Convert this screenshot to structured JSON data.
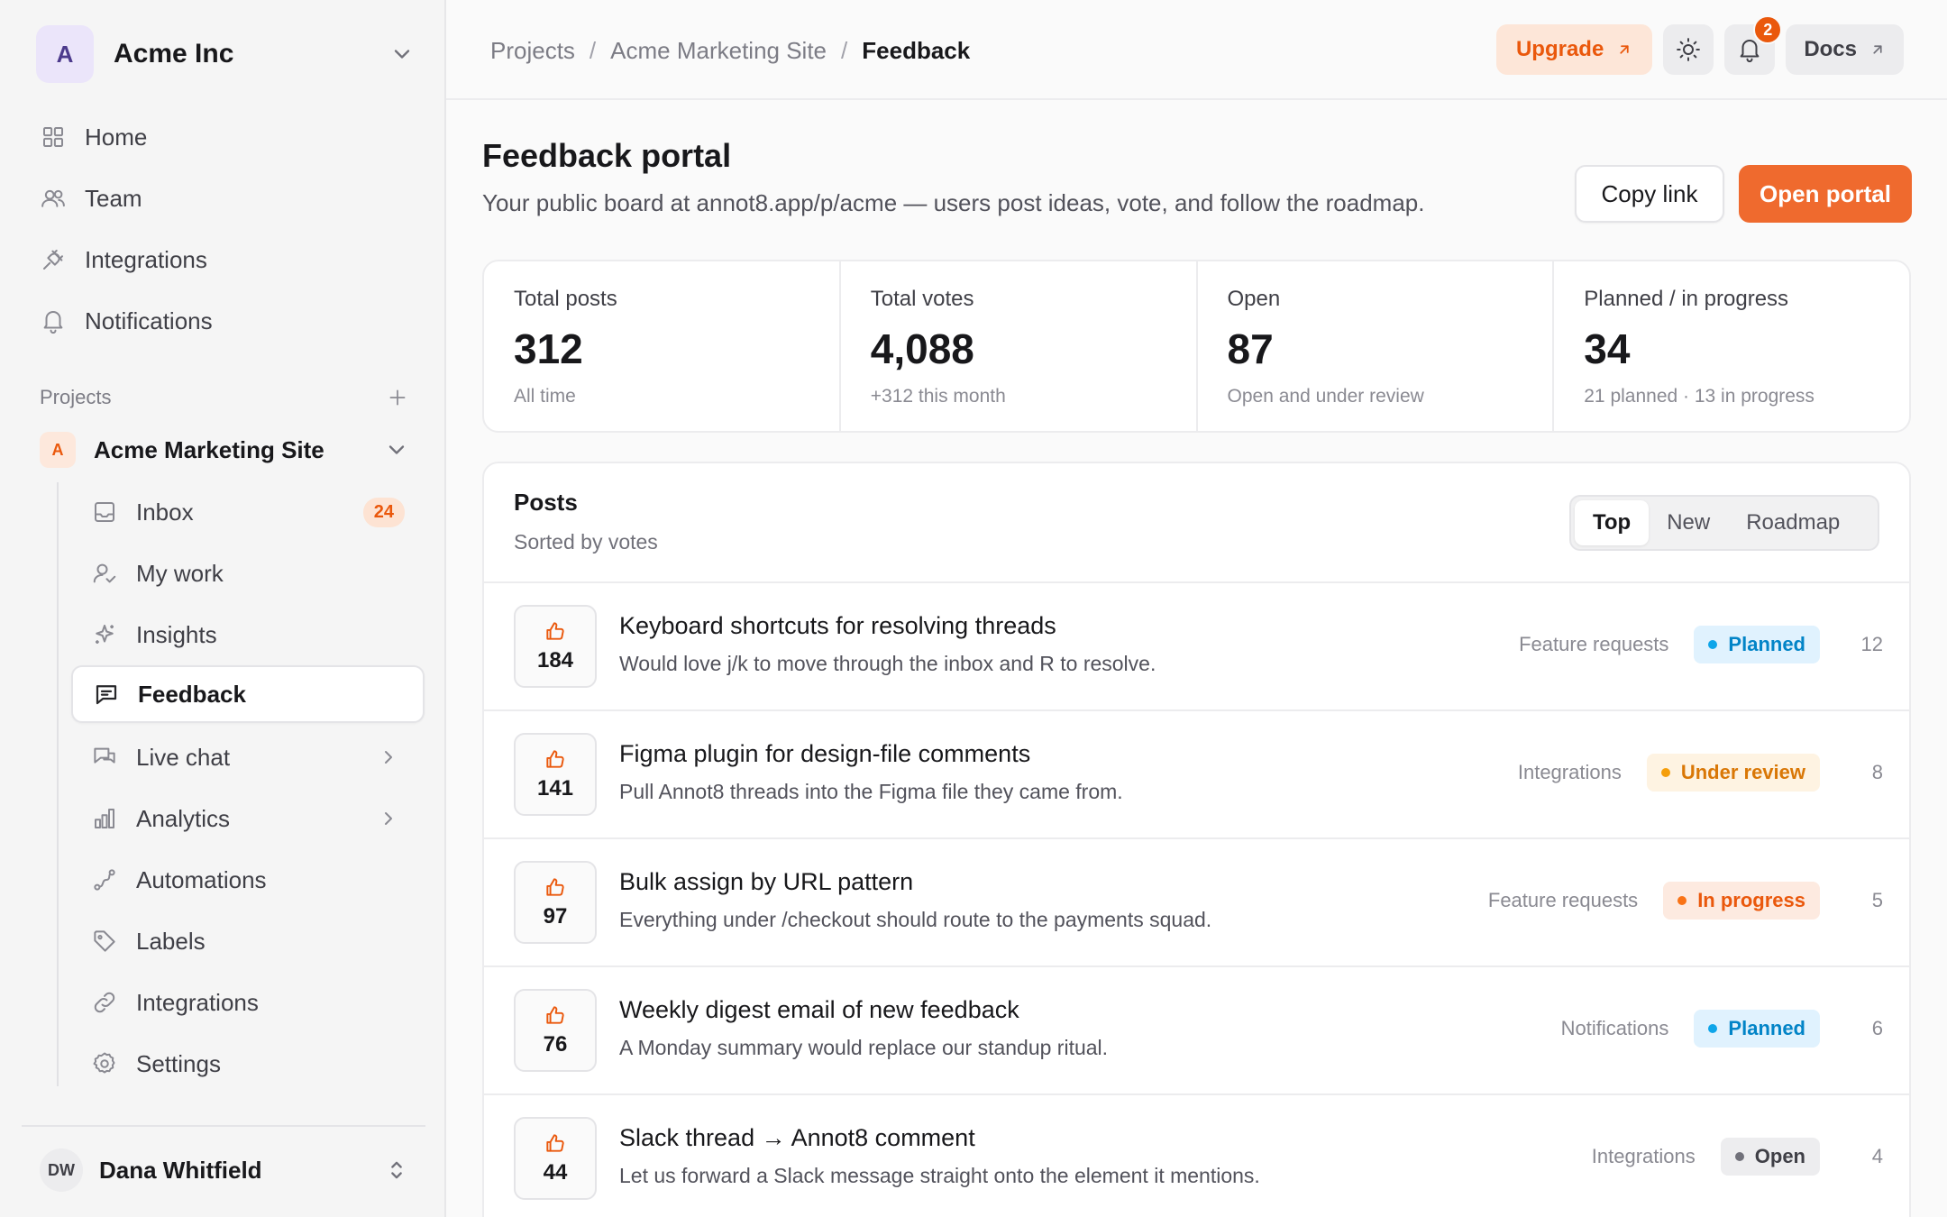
{
  "org": {
    "initial": "A",
    "name": "Acme Inc"
  },
  "nav": [
    {
      "label": "Home",
      "icon": "grid-icon"
    },
    {
      "label": "Team",
      "icon": "users-icon"
    },
    {
      "label": "Integrations",
      "icon": "plug-icon"
    },
    {
      "label": "Notifications",
      "icon": "bell-icon"
    }
  ],
  "projects": {
    "heading": "Projects",
    "current": {
      "initial": "A",
      "name": "Acme Marketing Site"
    },
    "items": [
      {
        "label": "Inbox",
        "icon": "inbox-icon",
        "badge": "24"
      },
      {
        "label": "My work",
        "icon": "user-check-icon"
      },
      {
        "label": "Insights",
        "icon": "sparkles-icon"
      },
      {
        "label": "Feedback",
        "icon": "message-square-icon",
        "active": true
      },
      {
        "label": "Live chat",
        "icon": "chat-icon",
        "expandable": true
      },
      {
        "label": "Analytics",
        "icon": "bar-chart-icon",
        "expandable": true
      },
      {
        "label": "Automations",
        "icon": "route-icon"
      },
      {
        "label": "Labels",
        "icon": "tag-icon"
      },
      {
        "label": "Integrations",
        "icon": "link-icon"
      },
      {
        "label": "Settings",
        "icon": "gear-icon"
      }
    ]
  },
  "user": {
    "initials": "DW",
    "name": "Dana Whitfield"
  },
  "breadcrumb": {
    "items": [
      "Projects",
      "Acme Marketing Site"
    ],
    "separator": "/",
    "current": "Feedback"
  },
  "topbar": {
    "upgrade": "Upgrade",
    "notifications_count": "2",
    "docs": "Docs"
  },
  "page": {
    "title": "Feedback portal",
    "subtitle": "Your public board at annot8.app/p/acme — users post ideas, vote, and follow the roadmap.",
    "copy_link": "Copy link",
    "open_portal": "Open portal"
  },
  "stats": [
    {
      "label": "Total posts",
      "value": "312",
      "note": "All time"
    },
    {
      "label": "Total votes",
      "value": "4,088",
      "note": "+312 this month"
    },
    {
      "label": "Open",
      "value": "87",
      "note": "Open and under review"
    },
    {
      "label": "Planned / in progress",
      "value": "34",
      "note": "21 planned · 13 in progress"
    }
  ],
  "posts": {
    "title": "Posts",
    "subtitle": "Sorted by votes",
    "tabs": [
      "Top",
      "New",
      "Roadmap"
    ],
    "active_tab": "Top",
    "rows": [
      {
        "votes": "184",
        "title": "Keyboard shortcuts for resolving threads",
        "desc": "Would love j/k to move through the inbox and R to resolve.",
        "category": "Feature requests",
        "status": "Planned",
        "status_kind": "planned",
        "comments": "12"
      },
      {
        "votes": "141",
        "title": "Figma plugin for design-file comments",
        "desc": "Pull Annot8 threads into the Figma file they came from.",
        "category": "Integrations",
        "status": "Under review",
        "status_kind": "review",
        "comments": "8"
      },
      {
        "votes": "97",
        "title": "Bulk assign by URL pattern",
        "desc": "Everything under /checkout should route to the payments squad.",
        "category": "Feature requests",
        "status": "In progress",
        "status_kind": "progress",
        "comments": "5"
      },
      {
        "votes": "76",
        "title": "Weekly digest email of new feedback",
        "desc": "A Monday summary would replace our standup ritual.",
        "category": "Notifications",
        "status": "Planned",
        "status_kind": "planned",
        "comments": "6"
      },
      {
        "votes": "44",
        "title": "Slack thread → Annot8 comment",
        "desc": "Let us forward a Slack message straight onto the element it mentions.",
        "category": "Integrations",
        "status": "Open",
        "status_kind": "open",
        "comments": "4"
      }
    ]
  },
  "colors": {
    "accent": "#ef6a2e",
    "accent_soft": "#fde6d8",
    "planned": "#0284c7",
    "review": "#d97706",
    "progress": "#ea580c"
  }
}
